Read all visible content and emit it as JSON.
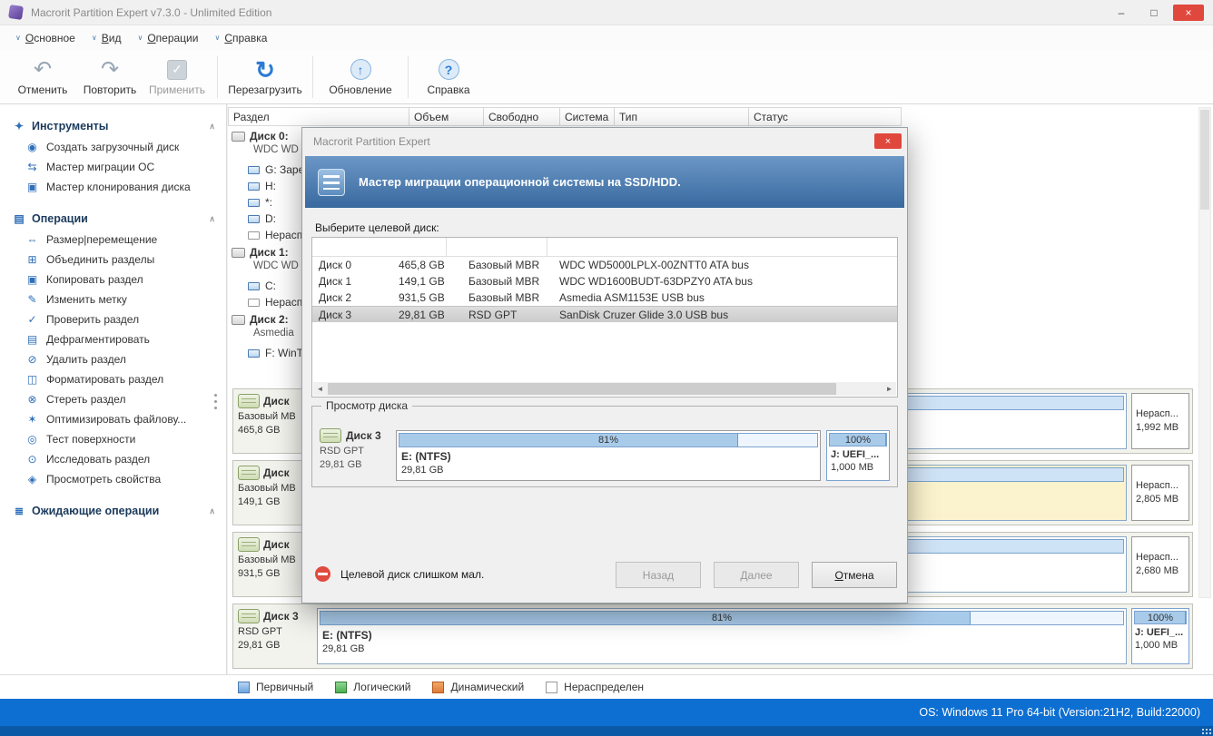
{
  "titlebar": {
    "title": "Macrorit Partition Expert v7.3.0 - Unlimited Edition"
  },
  "menubar": {
    "items": [
      {
        "label": "Основное"
      },
      {
        "label": "Вид"
      },
      {
        "label": "Операции"
      },
      {
        "label": "Справка"
      }
    ]
  },
  "toolbar": {
    "buttons": [
      {
        "label": "Отменить",
        "icon": "undo-icon",
        "enabled": true
      },
      {
        "label": "Повторить",
        "icon": "redo-icon",
        "enabled": true
      },
      {
        "label": "Применить",
        "icon": "apply-check-icon",
        "enabled": false
      },
      {
        "label": "Перезагрузить",
        "icon": "reload-icon",
        "enabled": true
      },
      {
        "label": "Обновление",
        "icon": "update-icon",
        "enabled": true
      },
      {
        "label": "Справка",
        "icon": "help-icon",
        "enabled": true
      }
    ]
  },
  "sidebar": {
    "sections": [
      {
        "title": "Инструменты",
        "icon": "tools-icon",
        "items": [
          {
            "label": "Создать загрузочный диск",
            "icon": "boot-disk-icon"
          },
          {
            "label": "Мастер миграции ОС",
            "icon": "migrate-os-icon"
          },
          {
            "label": "Мастер клонирования диска",
            "icon": "clone-disk-icon"
          }
        ]
      },
      {
        "title": "Операции",
        "icon": "operations-icon",
        "items": [
          {
            "label": "Размер|перемещение",
            "icon": "resize-icon"
          },
          {
            "label": "Объединить разделы",
            "icon": "merge-icon"
          },
          {
            "label": "Копировать раздел",
            "icon": "copy-icon"
          },
          {
            "label": "Изменить метку",
            "icon": "label-icon"
          },
          {
            "label": "Проверить раздел",
            "icon": "check-icon"
          },
          {
            "label": "Дефрагментировать",
            "icon": "defrag-icon"
          },
          {
            "label": "Удалить раздел",
            "icon": "delete-icon"
          },
          {
            "label": "Форматировать раздел",
            "icon": "format-icon"
          },
          {
            "label": "Стереть раздел",
            "icon": "wipe-icon"
          },
          {
            "label": "Оптимизировать файлову...",
            "icon": "optimize-icon"
          },
          {
            "label": "Тест поверхности",
            "icon": "surface-test-icon"
          },
          {
            "label": "Исследовать раздел",
            "icon": "explore-icon"
          },
          {
            "label": "Просмотреть свойства",
            "icon": "properties-icon"
          }
        ]
      },
      {
        "title": "Ожидающие операции",
        "icon": "pending-icon",
        "items": []
      }
    ]
  },
  "partition_table": {
    "columns": [
      "Раздел",
      "Объем",
      "Свободно",
      "Система",
      "Тип",
      "Статус"
    ],
    "rows": [
      {
        "kind": "disk",
        "line1": "Диск 0: ",
        "line2": "WDC WD"
      },
      {
        "kind": "volume",
        "label": "G: Зарез"
      },
      {
        "kind": "volume",
        "label": "H:"
      },
      {
        "kind": "volume",
        "label": "*:"
      },
      {
        "kind": "volume",
        "label": "D:"
      },
      {
        "kind": "unalloc",
        "label": "Нераспр"
      },
      {
        "kind": "disk",
        "line1": "Диск 1: ",
        "line2": "WDC WD"
      },
      {
        "kind": "volume",
        "label": "C:"
      },
      {
        "kind": "unalloc",
        "label": "Нераспр"
      },
      {
        "kind": "disk",
        "line1": "Диск 2: ",
        "line2": "Asmedia "
      },
      {
        "kind": "volume",
        "label": "F: WinTo"
      }
    ]
  },
  "disk_map": {
    "rows": [
      {
        "name": "Диск",
        "type": "Базовый MB",
        "size": "465,8 GB",
        "unalloc": {
          "label": "Нерасп...",
          "size": "1,992 MB"
        }
      },
      {
        "name": "Диск",
        "type": "Базовый MB",
        "size": "149,1 GB",
        "unalloc": {
          "label": "Нерасп...",
          "size": "2,805 MB"
        }
      },
      {
        "name": "Диск",
        "type": "Базовый MB",
        "size": "931,5 GB",
        "unalloc": {
          "label": "Нерасп...",
          "size": "2,680 MB"
        }
      },
      {
        "name": "Диск 3",
        "type": "RSD GPT",
        "size": "29,81 GB",
        "partition": {
          "label": "E: (NTFS)",
          "size": "29,81 GB",
          "percent": "81%"
        },
        "efi": {
          "percent": "100%",
          "label": "J: UEFI_...",
          "size": "1,000 MB"
        }
      }
    ]
  },
  "legend": {
    "items": [
      {
        "label": "Первичный",
        "color": "#6ea6dd"
      },
      {
        "label": "Логический",
        "color": "#4caf50"
      },
      {
        "label": "Динамический",
        "color": "#e07b39"
      },
      {
        "label": "Нераспределен",
        "color": "#ffffff"
      }
    ]
  },
  "statusbar": {
    "os_info": "OS: Windows 11 Pro 64-bit (Version:21H2, Build:22000)"
  },
  "dialog": {
    "title": "Macrorit Partition Expert",
    "header": "Мастер миграции операционной системы на SSD/HDD.",
    "select_label": "Выберите целевой диск:",
    "disks": [
      {
        "name": "Диск 0",
        "size": "465,8 GB",
        "type": "Базовый MBR",
        "model": "WDC WD5000LPLX-00ZNTT0 ATA bus",
        "selected": false
      },
      {
        "name": "Диск 1",
        "size": "149,1 GB",
        "type": "Базовый MBR",
        "model": "WDC WD1600BUDT-63DPZY0 ATA bus",
        "selected": false
      },
      {
        "name": "Диск 2",
        "size": "931,5 GB",
        "type": "Базовый MBR",
        "model": "Asmedia ASM1153E USB bus",
        "selected": false
      },
      {
        "name": "Диск 3",
        "size": "29,81 GB",
        "type": "RSD GPT",
        "model": "SanDisk Cruzer Glide 3.0 USB bus",
        "selected": true
      }
    ],
    "preview": {
      "group_title": "Просмотр диска",
      "disk": {
        "name": "Диск 3",
        "type": "RSD GPT",
        "size": "29,81 GB"
      },
      "partition": {
        "label": "E: (NTFS)",
        "size": "29,81 GB",
        "percent": "81%"
      },
      "efi": {
        "percent": "100%",
        "label": "J: UEFI_...",
        "size": "1,000 MB"
      }
    },
    "error": "Целевой диск слишком мал.",
    "buttons": {
      "back": "Назад",
      "next": "Далее",
      "cancel": "Отмена"
    }
  }
}
